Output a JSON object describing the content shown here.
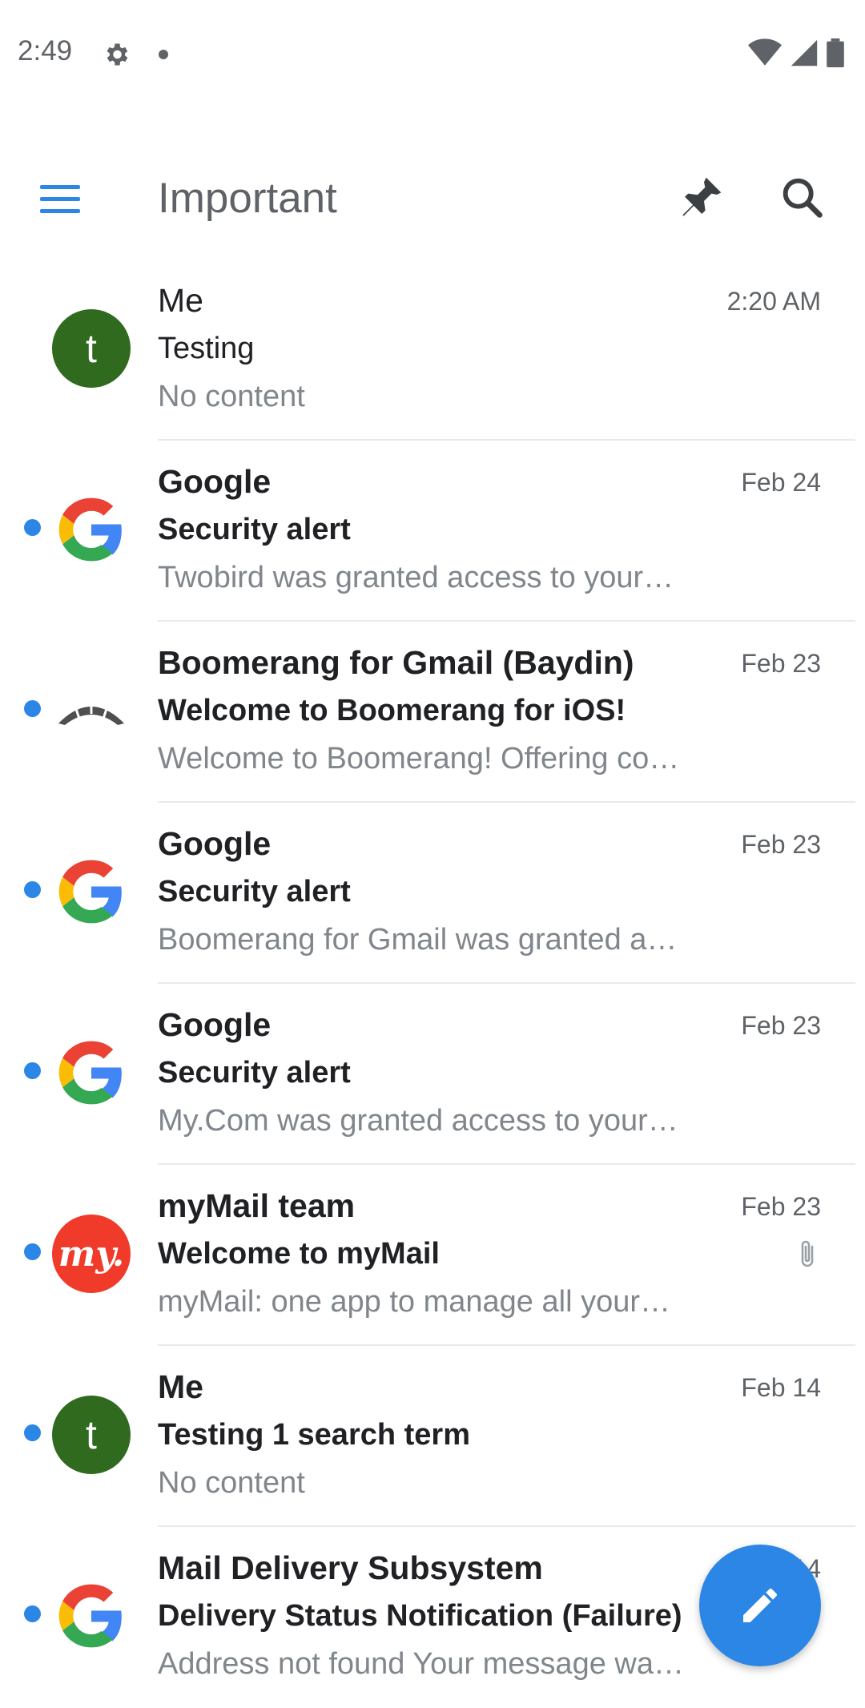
{
  "status_bar": {
    "time": "2:49"
  },
  "app_bar": {
    "title": "Important"
  },
  "colors": {
    "accent": "#2b86e6",
    "avatar_me": "#2f6a1f",
    "avatar_mymail": "#f03a2a"
  },
  "emails": [
    {
      "sender": "Me",
      "date": "2:20 AM",
      "subject": "Testing",
      "snippet": "No content",
      "unread": false,
      "avatar": "letter",
      "avatar_letter": "t"
    },
    {
      "sender": "Google",
      "date": "Feb 24",
      "subject": "Security alert",
      "snippet": "Twobird was granted access to your…",
      "unread": true,
      "avatar": "google-logo"
    },
    {
      "sender": "Boomerang for Gmail (Baydin)",
      "date": "Feb 23",
      "subject": "Welcome to Boomerang for iOS!",
      "snippet": "Welcome to Boomerang! Offering co…",
      "unread": true,
      "avatar": "boomerang-logo"
    },
    {
      "sender": "Google",
      "date": "Feb 23",
      "subject": "Security alert",
      "snippet": "Boomerang for Gmail was granted a…",
      "unread": true,
      "avatar": "google-logo"
    },
    {
      "sender": "Google",
      "date": "Feb 23",
      "subject": "Security alert",
      "snippet": "My.Com was granted access to your…",
      "unread": true,
      "avatar": "google-logo"
    },
    {
      "sender": "myMail team",
      "date": "Feb 23",
      "subject": "Welcome to myMail",
      "snippet": "myMail: one app to manage all your…",
      "unread": true,
      "avatar": "mymail-logo",
      "avatar_text": "my.",
      "attachment": true
    },
    {
      "sender": "Me",
      "date": "Feb 14",
      "subject": "Testing 1 search term",
      "snippet": "No content",
      "unread": true,
      "avatar": "letter",
      "avatar_letter": "t"
    },
    {
      "sender": "Mail Delivery Subsystem",
      "date": "Feb 14",
      "subject": "Delivery Status Notification (Failure)",
      "snippet": "Address not found Your message wa…",
      "unread": true,
      "avatar": "google-logo"
    }
  ]
}
